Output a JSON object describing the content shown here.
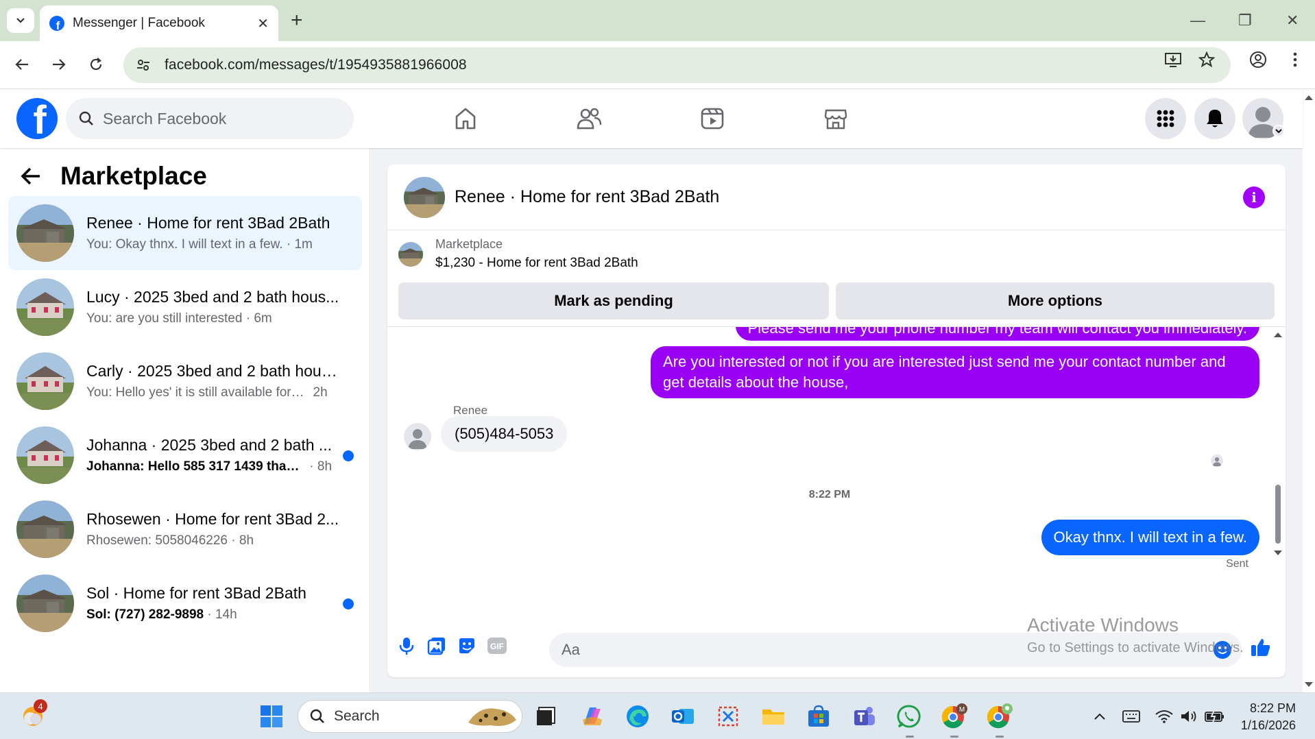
{
  "browser": {
    "tab_title": "Messenger | Facebook",
    "url": "facebook.com/messages/t/1954935881966008"
  },
  "header": {
    "search_placeholder": "Search Facebook"
  },
  "sidebar": {
    "title": "Marketplace",
    "conversations": [
      {
        "name": "Renee · Home for rent 3Bad 2Bath",
        "preview": "You: Okay thnx. I will text in a few.",
        "time": " · 1m",
        "unread": false,
        "active": true
      },
      {
        "name": "Lucy · 2025 3bed and 2 bath hous...",
        "preview": "You: are you still interested",
        "time": " · 6m",
        "unread": false,
        "active": false
      },
      {
        "name": "Carly · 2025 3bed and 2 bath hous...",
        "preview": "You: Hello yes' it is still available for re...",
        "time": "  2h",
        "unread": false,
        "active": false
      },
      {
        "name": "Johanna · 2025 3bed and 2 bath ...",
        "preview": "Johanna: Hello 585 317 1439 thank...",
        "time": " · 8h",
        "unread": true,
        "active": false
      },
      {
        "name": "Rhosewen · Home for rent 3Bad 2...",
        "preview": "Rhosewen: 5058046226",
        "time": " · 8h",
        "unread": false,
        "active": false
      },
      {
        "name": "Sol · Home for rent 3Bad 2Bath",
        "preview": "Sol: (727) 282-9898",
        "time": " · 14h",
        "unread": true,
        "active": false
      }
    ]
  },
  "chat": {
    "title": "Renee · Home for rent 3Bad 2Bath",
    "marketplace_label": "Marketplace",
    "listing": "$1,230 - Home for rent 3Bad 2Bath",
    "mark_pending": "Mark as pending",
    "more_options": "More options",
    "msg_partial": "Please send me your phone number my team will contact you immediately.",
    "msg_interest_line1": "Are you interested or not if you are interested just send me your contact number and",
    "msg_interest_line2": "get details about the house,",
    "sender_name": "Renee",
    "msg_phone": "(505)484-5053",
    "timestamp": "8:22 PM",
    "msg_last": "Okay thnx. I will text in a few.",
    "status": "Sent",
    "composer_placeholder": "Aa"
  },
  "watermark": {
    "line1": "Activate Windows",
    "line2": "Go to Settings to activate Windows."
  },
  "taskbar": {
    "search_label": "Search",
    "notification_count": "4",
    "time": "8:22 PM",
    "date": "1/16/2026"
  },
  "colors": {
    "facebook_blue": "#0866ff",
    "outgoing_purple": "#9a00f3",
    "chrome_green": "#d3e3cf"
  }
}
